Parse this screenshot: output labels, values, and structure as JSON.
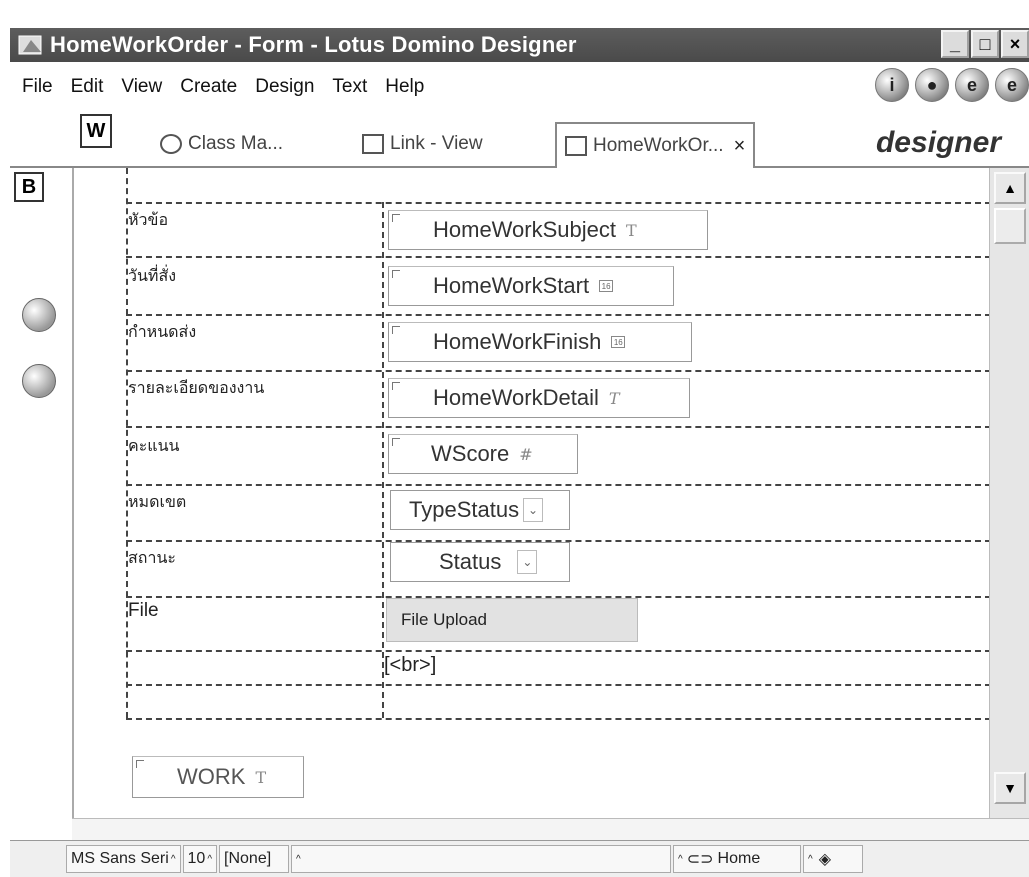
{
  "window": {
    "title": "HomeWorkOrder - Form - Lotus Domino Designer",
    "controls": [
      "_",
      "□",
      "×"
    ]
  },
  "menu": [
    {
      "label": "File"
    },
    {
      "label": "Edit"
    },
    {
      "label": "View"
    },
    {
      "label": "Create"
    },
    {
      "label": "Design"
    },
    {
      "label": "Text"
    },
    {
      "label": "Help"
    }
  ],
  "toolbar_icons": [
    "info-icon",
    "people-icon",
    "browser-icon",
    "ie-icon"
  ],
  "tabs": {
    "w_marker": "W",
    "items": [
      {
        "label": "Class Ma...",
        "active": false
      },
      {
        "label": "Link - View",
        "active": false
      },
      {
        "label": "HomeWorkOr...",
        "active": true
      }
    ],
    "brand": "designer"
  },
  "left": {
    "b_marker": "B"
  },
  "form": {
    "rows": [
      {
        "label": "หัวข้อ",
        "field": "HomeWorkSubject",
        "type": "T"
      },
      {
        "label": "วันที่สั่ง",
        "field": "HomeWorkStart",
        "type": "16"
      },
      {
        "label": "กำหนดส่ง",
        "field": "HomeWorkFinish",
        "type": "16"
      },
      {
        "label": "รายละเอียดของงาน",
        "field": "HomeWorkDetail",
        "type": "T"
      },
      {
        "label": "คะแนน",
        "field": "WScore",
        "type": "#"
      },
      {
        "label": "หมดเขต",
        "field": "TypeStatus"
      },
      {
        "label": "สถานะ",
        "field": "Status"
      },
      {
        "label": "File",
        "field": "File Upload"
      }
    ],
    "br_tag": "[<br>]",
    "work_field": {
      "name": "WORK",
      "type": "T"
    }
  },
  "status": {
    "font": "MS Sans Seri",
    "size": "10",
    "style": "[None]",
    "location": "Home"
  }
}
